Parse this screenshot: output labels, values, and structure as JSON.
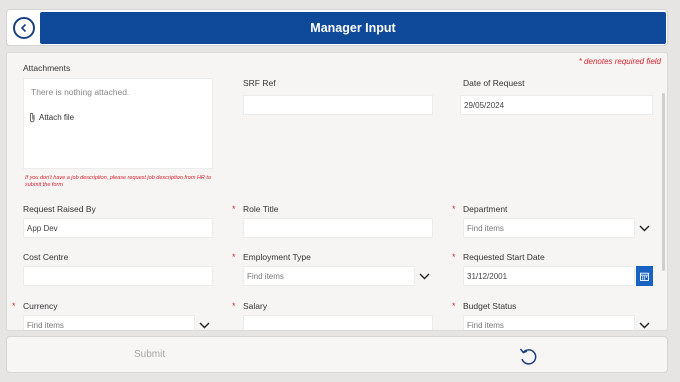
{
  "header": {
    "title": "Manager Input",
    "back_icon": "chevron-left-icon"
  },
  "form": {
    "required_note": "* denotes required field",
    "attachments": {
      "label": "Attachments",
      "empty_text": "There is nothing attached.",
      "attach_label": "Attach file",
      "warning": "If you don't have a job description, please request job description from HR to submit the form"
    },
    "srf_ref": {
      "label": "SRF Ref",
      "value": ""
    },
    "date_of_request": {
      "label": "Date of Request",
      "value": "29/05/2024"
    },
    "request_raised_by": {
      "label": "Request Raised By",
      "value": "App Dev"
    },
    "role_title": {
      "label": "Role Title",
      "value": "",
      "required": "*"
    },
    "department": {
      "label": "Department",
      "placeholder": "Find items",
      "required": "*"
    },
    "cost_centre": {
      "label": "Cost Centre",
      "value": ""
    },
    "employment_type": {
      "label": "Employment Type",
      "placeholder": "Find items",
      "required": "*"
    },
    "requested_start_date": {
      "label": "Requested Start Date",
      "value": "31/12/2001",
      "required": "*"
    },
    "currency": {
      "label": "Currency",
      "placeholder": "Find items",
      "required": "*"
    },
    "salary": {
      "label": "Salary",
      "value": "",
      "required": "*"
    },
    "budget_status": {
      "label": "Budget Status",
      "placeholder": "Find items",
      "required": "*"
    }
  },
  "footer": {
    "submit_label": "Submit",
    "reset_icon": "undo-icon"
  },
  "colors": {
    "brand": "#0f4a9a",
    "required": "#e0232e",
    "calendar_button": "#1862c4"
  }
}
